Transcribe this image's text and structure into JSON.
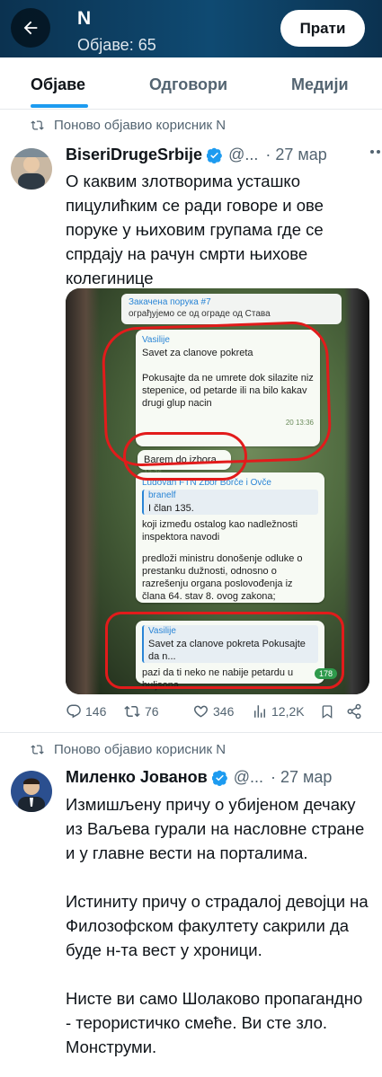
{
  "header": {
    "name": "N",
    "posts_count": "Објаве: 65",
    "follow_label": "Прати"
  },
  "tabs": [
    {
      "label": "Објаве",
      "active": true
    },
    {
      "label": "Одговори",
      "active": false
    },
    {
      "label": "Медији",
      "active": false
    }
  ],
  "posts": [
    {
      "repost_label": "Поново објавио корисник N",
      "author_name": "BiseriDrugeSrbije",
      "verified": true,
      "handle": "@...",
      "date": "· 27 мар",
      "text": "О каквим злотворима усташко пицулићким се ради говоре и ове поруке у њиховим групама где се спрдају на рачун смрти њихове колегинице",
      "media": {
        "pinned_title": "Закачена порука #7",
        "pinned_text": "ограђујемо се од ограде од Става",
        "msg1_sender": "Vasilije",
        "msg1_line1": "Savet za clanove pokreta",
        "msg1_line2": "Pokusajte da ne umrete dok silazite niz stepenice, od petarde ili na bilo kakav drugi glup nacin",
        "msg1_meta": "20 13:36",
        "msg2_text": "Barem do izbora",
        "msg2_meta": "13:36",
        "msg3_group": "Ludovan FTN Zbor Borče i Ovče",
        "msg3_quote_sender": "branelf",
        "msg3_quote_text": "I član 135.",
        "msg3_line1": "koji između ostalog kao nadležnosti inspektora navodi",
        "msg3_line2": "predloži ministru donošenje odluke o prestanku dužnosti, odnosno o razrešenju organa poslovođenja iz člana 64. stav 8. ovog zakona;",
        "msg4_quote_sender": "Vasilije",
        "msg4_quote_text": "Savet za clanove pokreta Pokusajte da n...",
        "msg4_text": "pazi da ti neko ne nabije petardu u buljsona....",
        "badge": "178"
      },
      "stats": {
        "replies": "146",
        "reposts": "76",
        "likes": "346",
        "views": "12,2K"
      }
    },
    {
      "repost_label": "Поново објавио корисник N",
      "author_name": "Миленко Јованов",
      "verified": true,
      "handle": "@...",
      "date": "· 27 мар",
      "paragraphs": [
        "Измишљену причу о убијеном дечаку из Ваљева гурали на насловне стране и у главне вести на порталима.",
        "Истиниту причу о страдалој девојци на Филозофском факултету сакрили да буде н-та вест у хроници.",
        "Нисте ви само Шолаково пропагандно - терористичко смеће. Ви сте зло. Монструми."
      ]
    }
  ],
  "colors": {
    "accent": "#1d9bf0",
    "header_bg": "#0c3a5c",
    "muted": "#536471",
    "red_marker": "#e21b1b"
  },
  "icons": [
    "back-arrow-icon",
    "repost-icon",
    "verified-icon",
    "more-icon",
    "reply-icon",
    "like-icon",
    "views-icon",
    "bookmark-icon",
    "share-icon"
  ]
}
